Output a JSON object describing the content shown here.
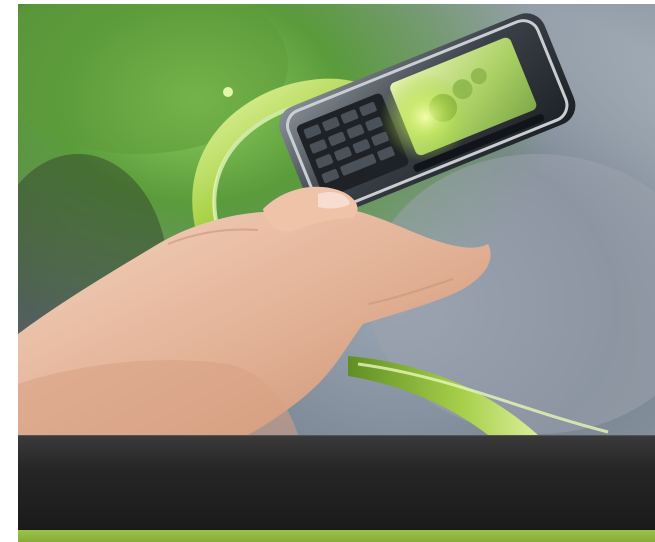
{
  "image": {
    "subject": "hand-holding-smartphone",
    "accent_green": "#8dbb3f",
    "dark_band_color": "#222222"
  }
}
